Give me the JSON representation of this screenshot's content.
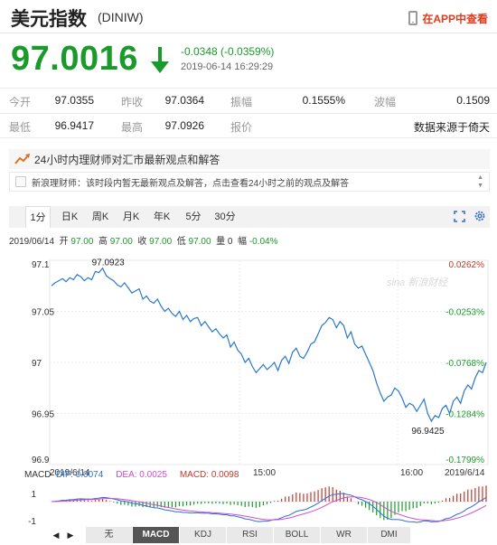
{
  "header": {
    "title": "美元指数",
    "code": "(DINIW)",
    "app_link": "在APP中查看"
  },
  "quote": {
    "price": "97.0016",
    "change": "-0.0348 (-0.0359%)",
    "timestamp": "2019-06-14 16:29:29",
    "direction": "down",
    "color": "#1a9a2a"
  },
  "stats": {
    "row1": [
      {
        "label": "今开",
        "value": "97.0355"
      },
      {
        "label": "昨收",
        "value": "97.0364"
      },
      {
        "label": "振幅",
        "value": "0.1555%"
      },
      {
        "label": "波幅",
        "value": "0.1509"
      }
    ],
    "row2": [
      {
        "label": "最低",
        "value": "96.9417"
      },
      {
        "label": "最高",
        "value": "97.0926"
      },
      {
        "label": "报价",
        "value": "数据来源于倚天"
      }
    ]
  },
  "news": {
    "title": "24小时内理财师对汇市最新观点和解答",
    "message": "新浪理财师：该时段内暂无最新观点及解答，点击查看24小时之前的观点及解答"
  },
  "tabs": [
    "1分",
    "日K",
    "周K",
    "月K",
    "年K",
    "5分",
    "30分"
  ],
  "active_tab": "1分",
  "info": {
    "date": "2019/06/14",
    "open_label": "开",
    "open": "97.00",
    "high_label": "高",
    "high": "97.00",
    "close_label": "收",
    "close": "97.00",
    "low_label": "低",
    "low": "97.00",
    "volume_label": "量",
    "volume": "0",
    "amplitude_label": "幅",
    "amplitude": "-0.04%"
  },
  "chart_data": {
    "type": "line",
    "ylim": [
      96.9,
      97.1
    ],
    "y_ticks": [
      "97.1",
      "97.05",
      "97",
      "96.95",
      "96.9"
    ],
    "pct_ticks": [
      "0.0262%",
      "-0.0253%",
      "-0.0768%",
      "-0.1284%",
      "-0.1799%"
    ],
    "x_ticks": [
      "2019/6/14",
      "15:00",
      "16:00",
      "2019/6/14"
    ],
    "high_label": "97.0923",
    "low_label": "96.9425",
    "watermark": "sina 新浪财经",
    "values": [
      97.075,
      97.078,
      97.08,
      97.082,
      97.079,
      97.083,
      97.081,
      97.086,
      97.084,
      97.08,
      97.083,
      97.081,
      97.089,
      97.088,
      97.0923,
      97.085,
      97.082,
      97.08,
      97.076,
      97.074,
      97.078,
      97.073,
      97.068,
      97.07,
      97.072,
      97.062,
      97.065,
      97.06,
      97.058,
      97.062,
      97.055,
      97.05,
      97.053,
      97.048,
      97.045,
      97.05,
      97.042,
      97.046,
      97.04,
      97.043,
      97.044,
      97.036,
      97.04,
      97.035,
      97.03,
      97.033,
      97.028,
      97.024,
      97.027,
      97.015,
      97.02,
      97.012,
      97.008,
      97.0,
      97.004,
      96.996,
      96.99,
      96.994,
      96.998,
      96.993,
      96.996,
      97.0,
      96.992,
      97.002,
      97.006,
      96.999,
      97.01,
      97.014,
      97.006,
      97.004,
      97.01,
      97.018,
      97.02,
      97.028,
      97.036,
      97.039,
      97.044,
      97.042,
      97.034,
      97.04,
      97.036,
      97.024,
      97.03,
      97.018,
      97.014,
      97.016,
      97.008,
      97.0,
      96.992,
      96.98,
      96.97,
      96.962,
      96.966,
      96.968,
      96.975,
      96.972,
      96.965,
      96.956,
      96.96,
      96.958,
      96.952,
      96.958,
      96.964,
      96.95,
      96.9425,
      96.948,
      96.946,
      96.955,
      96.958,
      96.95,
      96.962,
      96.966,
      96.96,
      96.972,
      96.978,
      96.974,
      96.985,
      96.992,
      96.99,
      97.0
    ]
  },
  "macd": {
    "label": "MACD",
    "dif_label": "DIF: 0.0074",
    "dea_label": "DEA: 0.0025",
    "macd_label": "MACD: 0.0098",
    "dif_color": "#2a6fd6",
    "dea_color": "#d24bd2",
    "macd_color": "#c0392b",
    "y_ticks": [
      "1",
      "-1"
    ]
  },
  "bottom_tabs": [
    "无",
    "MACD",
    "KDJ",
    "RSI",
    "BOLL",
    "WR",
    "DMI"
  ],
  "bottom_active": "MACD",
  "colors": {
    "line": "#2a79c9",
    "up": "#c0392b",
    "down": "#1a9a2a",
    "accent": "#e03a1f"
  }
}
